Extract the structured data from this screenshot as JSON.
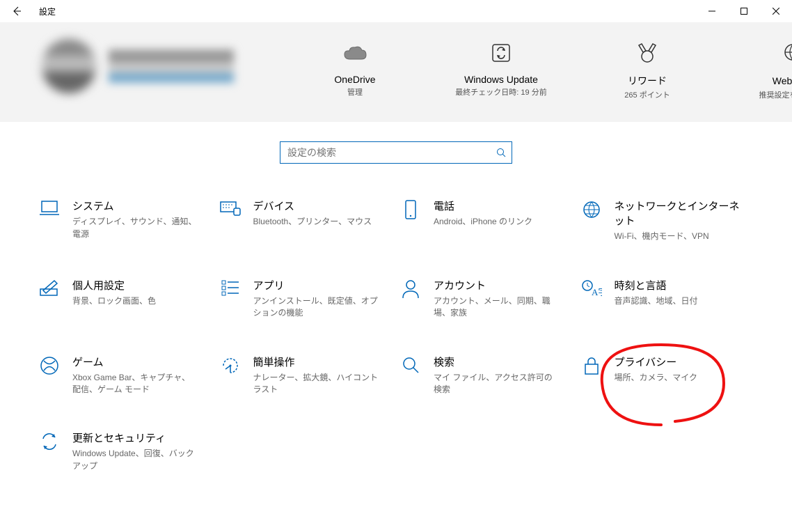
{
  "window": {
    "title": "設定"
  },
  "search": {
    "placeholder": "設定の検索"
  },
  "tiles": {
    "onedrive": {
      "label": "OneDrive",
      "desc": "管理"
    },
    "update": {
      "label": "Windows Update",
      "desc": "最終チェック日時: 19 分前"
    },
    "rewards": {
      "label": "リワード",
      "desc": "265 ポイント"
    },
    "web": {
      "label": "Web 閲覧",
      "desc": "推奨設定を復元する"
    }
  },
  "categories": {
    "system": {
      "label": "システム",
      "desc": "ディスプレイ、サウンド、通知、電源"
    },
    "devices": {
      "label": "デバイス",
      "desc": "Bluetooth、プリンター、マウス"
    },
    "phone": {
      "label": "電話",
      "desc": "Android、iPhone のリンク"
    },
    "network": {
      "label": "ネットワークとインターネット",
      "desc": "Wi-Fi、機内モード、VPN"
    },
    "personal": {
      "label": "個人用設定",
      "desc": "背景、ロック画面、色"
    },
    "apps": {
      "label": "アプリ",
      "desc": "アンインストール、既定値、オプションの機能"
    },
    "accounts": {
      "label": "アカウント",
      "desc": "アカウント、メール、同期、職場、家族"
    },
    "time": {
      "label": "時刻と言語",
      "desc": "音声認識、地域、日付"
    },
    "gaming": {
      "label": "ゲーム",
      "desc": "Xbox Game Bar、キャプチャ、配信、ゲーム モード"
    },
    "ease": {
      "label": "簡単操作",
      "desc": "ナレーター、拡大鏡、ハイコントラスト"
    },
    "searchcat": {
      "label": "検索",
      "desc": "マイ ファイル、アクセス許可の検索"
    },
    "privacy": {
      "label": "プライバシー",
      "desc": "場所、カメラ、マイク"
    },
    "updatesec": {
      "label": "更新とセキュリティ",
      "desc": "Windows Update、回復、バックアップ"
    }
  }
}
